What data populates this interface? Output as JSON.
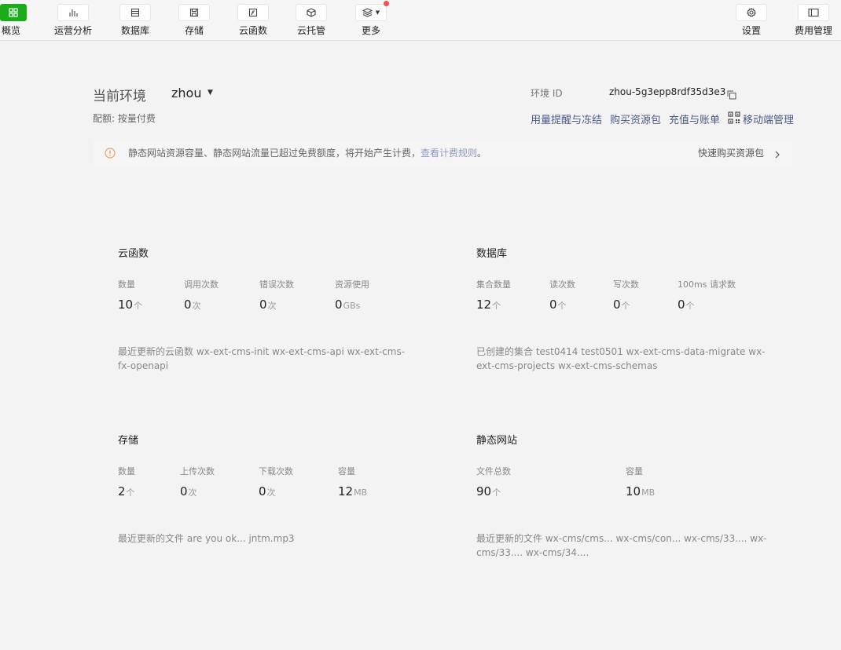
{
  "toolbar": {
    "items": [
      {
        "label": "概览",
        "icon": "overview-grid-icon",
        "active": true
      },
      {
        "label": "运营分析",
        "icon": "bar-chart-icon"
      },
      {
        "label": "数据库",
        "icon": "database-icon"
      },
      {
        "label": "存储",
        "icon": "storage-disk-icon"
      },
      {
        "label": "云函数",
        "icon": "function-icon"
      },
      {
        "label": "云托管",
        "icon": "cube-icon"
      },
      {
        "label": "更多",
        "icon": "layers-icon"
      },
      {
        "label": "设置",
        "icon": "gear-icon"
      },
      {
        "label": "费用管理",
        "icon": "billing-panel-icon"
      }
    ],
    "accent": "#1aad19",
    "badge_color": "#f05050"
  },
  "env": {
    "label": "当前环境",
    "name": "zhou",
    "quota": "配额: 按量付费",
    "id_label": "环境 ID",
    "id_value": "zhou-5g3epp8rdf35d3e3"
  },
  "links": {
    "usage_alert": "用量提醒与冻结",
    "buy_package": "购买资源包",
    "recharge": "充值与账单",
    "mobile": "移动端管理"
  },
  "notice": {
    "text": "静态网站资源容量、静态网站流量已超过免费额度，将开始产生计费，",
    "link": "查看计费规则",
    "end": "。",
    "action": "快速购买资源包"
  },
  "functions": {
    "title": "云函数",
    "stats": [
      {
        "label": "数量",
        "value": "10",
        "unit": "个"
      },
      {
        "label": "调用次数",
        "value": "0",
        "unit": "次"
      },
      {
        "label": "错误次数",
        "value": "0",
        "unit": "次"
      },
      {
        "label": "资源使用",
        "value": "0",
        "unit": "GBs"
      }
    ],
    "recent_label": "最近更新的云函数",
    "recent_items": "wx-ext-cms-init  wx-ext-cms-api  wx-ext-cms-fx-openapi"
  },
  "database": {
    "title": "数据库",
    "stats": [
      {
        "label": "集合数量",
        "value": "12",
        "unit": "个"
      },
      {
        "label": "读次数",
        "value": "0",
        "unit": "个"
      },
      {
        "label": "写次数",
        "value": "0",
        "unit": "个"
      },
      {
        "label": "100ms 请求数",
        "value": "0",
        "unit": "个"
      }
    ],
    "recent_label": "已创建的集合",
    "recent_items": "test0414  test0501  wx-ext-cms-data-migrate  wx-ext-cms-projects  wx-ext-cms-schemas"
  },
  "storage": {
    "title": "存储",
    "stats": [
      {
        "label": "数量",
        "value": "2",
        "unit": "个"
      },
      {
        "label": "上传次数",
        "value": "0",
        "unit": "次"
      },
      {
        "label": "下载次数",
        "value": "0",
        "unit": "次"
      },
      {
        "label": "容量",
        "value": "12",
        "unit": "MB"
      }
    ],
    "recent_label": "最近更新的文件",
    "recent_items": "are you ok...  jntm.mp3"
  },
  "website": {
    "title": "静态网站",
    "stats": [
      {
        "label": "文件总数",
        "value": "90",
        "unit": "个"
      },
      {
        "label": "容量",
        "value": "10",
        "unit": "MB"
      }
    ],
    "recent_label": "最近更新的文件",
    "recent_items": "wx-cms/cms...  wx-cms/con...  wx-cms/33....  wx-cms/33....  wx-cms/34...."
  }
}
